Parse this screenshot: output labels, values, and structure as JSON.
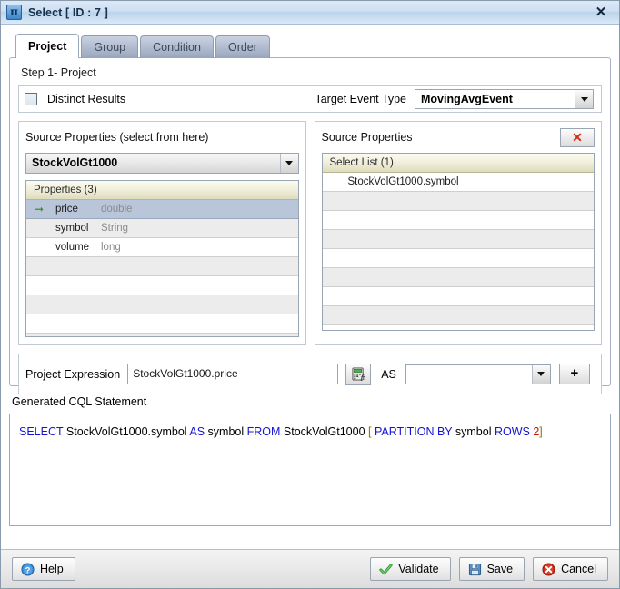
{
  "window": {
    "title": "Select [ ID : 7 ]",
    "title_icon": "pi-projection-icon",
    "close_label": "✕"
  },
  "tabs": [
    {
      "label": "Project",
      "active": true
    },
    {
      "label": "Group",
      "active": false
    },
    {
      "label": "Condition",
      "active": false
    },
    {
      "label": "Order",
      "active": false
    }
  ],
  "step": {
    "label": "Step 1- Project"
  },
  "distinct": {
    "label": "Distinct Results",
    "checked": false
  },
  "target_event": {
    "label": "Target Event Type",
    "value": "MovingAvgEvent"
  },
  "source_panel": {
    "title": "Source Properties (select from here)",
    "stream": "StockVolGt1000",
    "list_header": "Properties (3)",
    "properties": [
      {
        "name": "price",
        "type": "double",
        "selected": true
      },
      {
        "name": "symbol",
        "type": "String",
        "selected": false
      },
      {
        "name": "volume",
        "type": "long",
        "selected": false
      }
    ],
    "empty_rows": 5
  },
  "select_panel": {
    "title": "Source Properties",
    "delete_label": "✕",
    "list_header": "Select List (1)",
    "items": [
      "StockVolGt1000.symbol"
    ],
    "empty_rows": 7
  },
  "expression": {
    "label": "Project Expression",
    "value": "StockVolGt1000.price",
    "placeholder": "",
    "fx_icon": "function-calculator-icon",
    "as_label": "AS",
    "as_value": "",
    "add_label": "+"
  },
  "cql": {
    "label": "Generated CQL Statement",
    "tokens": [
      {
        "t": "SELECT",
        "c": "kw"
      },
      {
        "t": " StockVolGt1000.symbol ",
        "c": ""
      },
      {
        "t": "AS",
        "c": "kw"
      },
      {
        "t": " symbol ",
        "c": ""
      },
      {
        "t": "FROM",
        "c": "kw"
      },
      {
        "t": " StockVolGt1000  ",
        "c": ""
      },
      {
        "t": "[",
        "c": "brk"
      },
      {
        "t": " ",
        "c": ""
      },
      {
        "t": "PARTITION BY",
        "c": "kw"
      },
      {
        "t": " symbol  ",
        "c": ""
      },
      {
        "t": "ROWS",
        "c": "kw"
      },
      {
        "t": " ",
        "c": ""
      },
      {
        "t": "2",
        "c": "num"
      },
      {
        "t": "]",
        "c": "brk"
      }
    ],
    "plain": "SELECT StockVolGt1000.symbol AS symbol FROM StockVolGt1000  [ PARTITION BY symbol  ROWS 2]"
  },
  "footer": {
    "help": "Help",
    "validate": "Validate",
    "save": "Save",
    "cancel": "Cancel"
  },
  "colors": {
    "accent_blue": "#1414d2",
    "bracket": "#8a7a00",
    "number_red": "#c01010",
    "selection": "#b9c5d8",
    "list_header": "#f2f0dd",
    "titlebar": "#cfe0f3",
    "danger": "#d62b13",
    "ok_green": "#3f8f2c"
  }
}
